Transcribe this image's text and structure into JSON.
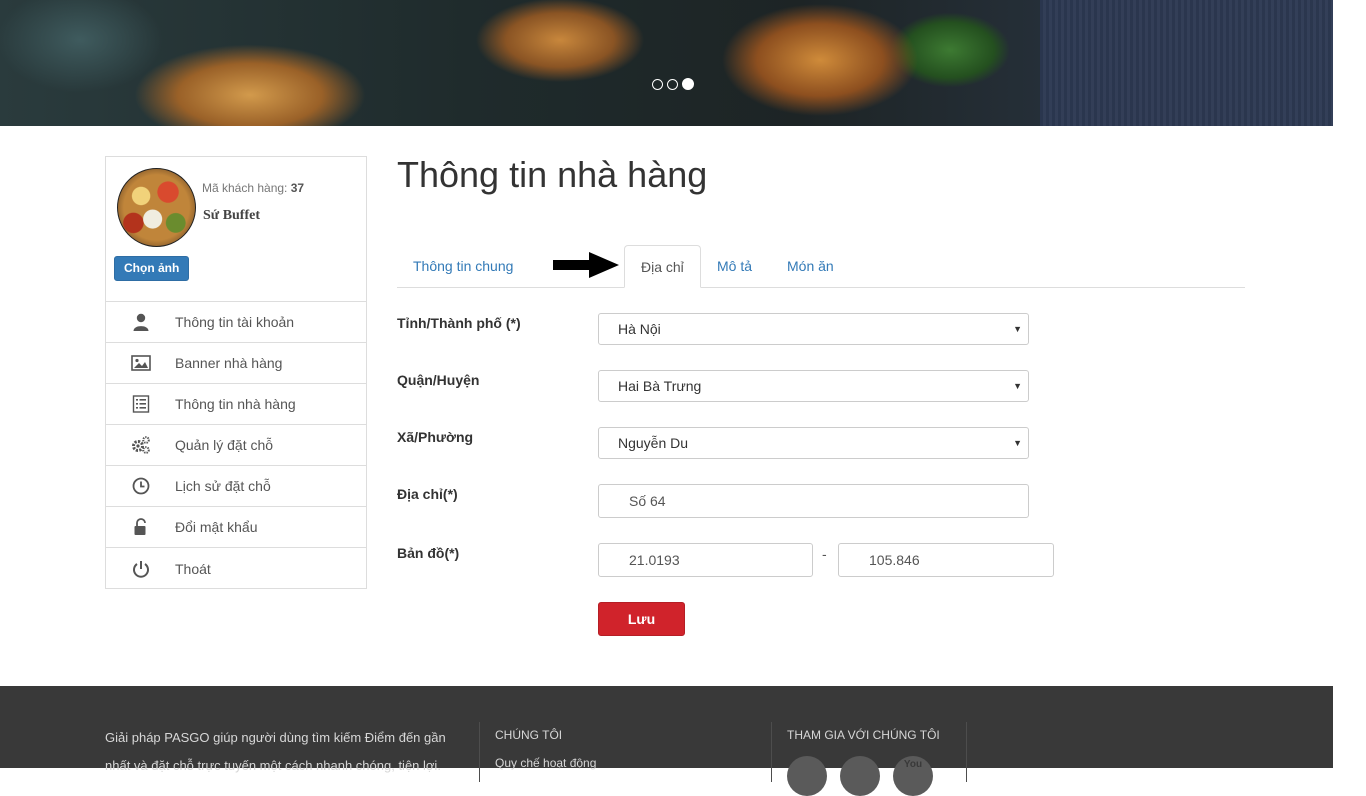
{
  "hero": {
    "slides": 3,
    "active_slide": 3
  },
  "profile": {
    "customer_code_label": "Mã khách hàng:",
    "customer_code": "37",
    "name": "Sứ Buffet",
    "choose_image": "Chọn ảnh"
  },
  "sidebar": {
    "items": [
      {
        "label": "Thông tin tài khoản",
        "icon": "user-icon"
      },
      {
        "label": "Banner nhà hàng",
        "icon": "image-icon"
      },
      {
        "label": "Thông tin nhà hàng",
        "icon": "document-icon"
      },
      {
        "label": "Quản lý đặt chỗ",
        "icon": "gears-icon"
      },
      {
        "label": "Lịch sử đặt chỗ",
        "icon": "clock-icon"
      },
      {
        "label": "Đổi mật khẩu",
        "icon": "unlock-icon"
      },
      {
        "label": "Thoát",
        "icon": "power-icon"
      }
    ]
  },
  "main": {
    "title": "Thông tin nhà hàng",
    "tabs": [
      {
        "label": "Thông tin chung"
      },
      {
        "label": "Địa chỉ",
        "active": true
      },
      {
        "label": "Mô tả"
      },
      {
        "label": "Món ăn"
      }
    ]
  },
  "form": {
    "province": {
      "label": "Tỉnh/Thành phố (*)",
      "value": "Hà Nội"
    },
    "district": {
      "label": "Quận/Huyện",
      "value": "Hai Bà Trưng"
    },
    "ward": {
      "label": "Xã/Phường",
      "value": "Nguyễn Du"
    },
    "address": {
      "label": "Địa chỉ(*)",
      "value": "Số 64"
    },
    "map": {
      "label": "Bản đồ(*)",
      "lat": "21.0193",
      "separator": "-",
      "lng": "105.846"
    },
    "save_label": "Lưu"
  },
  "footer": {
    "about": "Giải pháp PASGO giúp người dùng tìm kiếm Điểm đến gần nhất và đặt chỗ trực tuyến một cách nhanh chóng, tiện lợi.",
    "col2_heading": "CHÚNG TÔI",
    "col2_link": "Quy chế hoạt động",
    "col3_heading": "THAM GIA VỚI CHÚNG TÔI",
    "social_youtube": "You"
  },
  "colors": {
    "primary": "#337ab7",
    "danger": "#d0232b",
    "footer_bg": "#393939"
  }
}
